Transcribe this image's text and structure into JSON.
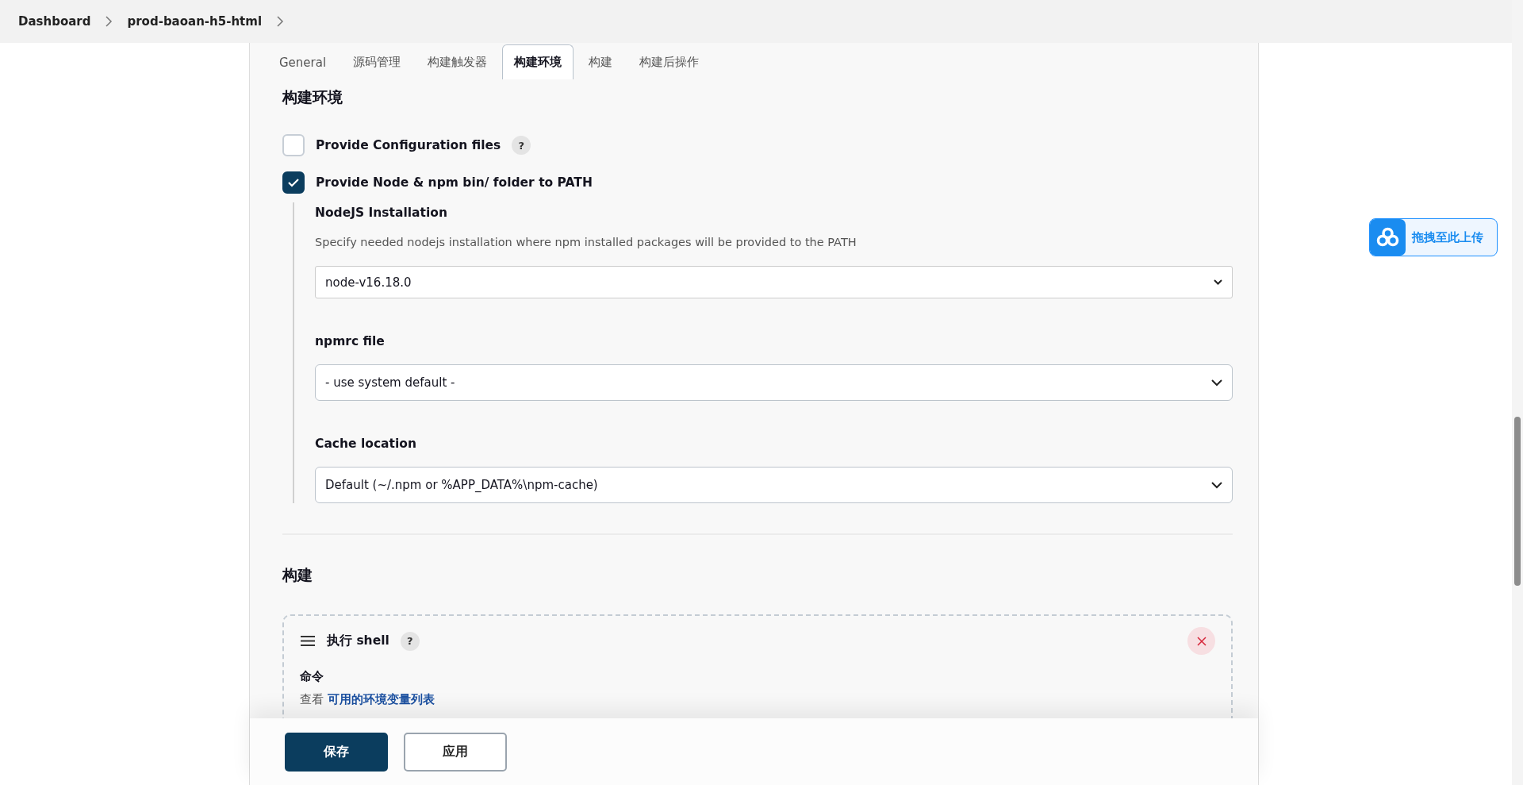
{
  "breadcrumbs": [
    {
      "label": "Dashboard"
    },
    {
      "label": "prod-baoan-h5-html"
    }
  ],
  "tabs": [
    {
      "label": "General",
      "selected": false
    },
    {
      "label": "源码管理",
      "selected": false
    },
    {
      "label": "构建触发器",
      "selected": false
    },
    {
      "label": "构建环境",
      "selected": true
    },
    {
      "label": "构建",
      "selected": false
    },
    {
      "label": "构建后操作",
      "selected": false
    }
  ],
  "environment": {
    "heading": "构建环境",
    "options": [
      {
        "label": "Provide Configuration files",
        "checked": false,
        "help": "?"
      },
      {
        "label": "Provide Node & npm bin/ folder to PATH",
        "checked": true
      }
    ],
    "nodejs": {
      "label": "NodeJS Installation",
      "description": "Specify needed nodejs installation where npm installed packages will be provided to the PATH",
      "value": "node-v16.18.0"
    },
    "npmrc": {
      "label": "npmrc file",
      "value": "- use system default -"
    },
    "cache": {
      "label": "Cache location",
      "value": "Default (~/.npm or %APP_DATA%\\npm-cache)"
    }
  },
  "build": {
    "heading": "构建",
    "step": {
      "title": "执行 shell",
      "help": "?",
      "command_label": "命令",
      "hint_prefix": "查看",
      "hint_link": "可用的环境变量列表"
    }
  },
  "buttons": [
    {
      "label": "保存",
      "kind": "primary"
    },
    {
      "label": "应用",
      "kind": "secondary"
    }
  ],
  "upload_widget": {
    "label": "拖拽至此上传"
  }
}
